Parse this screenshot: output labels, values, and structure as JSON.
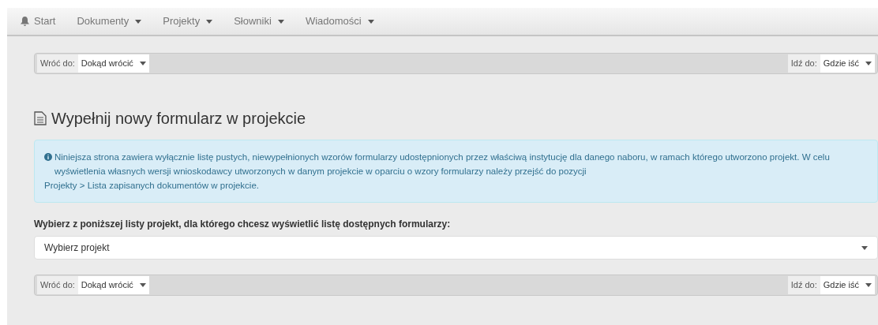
{
  "nav": [
    {
      "label": "Start",
      "kind": "home"
    },
    {
      "label": "Dokumenty",
      "kind": "dropdown"
    },
    {
      "label": "Projekty",
      "kind": "dropdown"
    },
    {
      "label": "Słowniki",
      "kind": "dropdown"
    },
    {
      "label": "Wiadomości",
      "kind": "dropdown"
    }
  ],
  "toolbars": [
    {
      "back_label": "Wróć do:",
      "back_value": "Dokąd wrócić",
      "go_label": "Idź do:",
      "go_value": "Gdzie iść"
    },
    {
      "back_label": "Wróć do:",
      "back_value": "Dokąd wrócić",
      "go_label": "Idź do:",
      "go_value": "Gdzie iść"
    }
  ],
  "heading": "Wypełnij nowy formularz w projekcie",
  "info": {
    "text": "Niniejsza strona zawiera wyłącznie listę pustych, niewypełnionych wzorów formularzy udostępnionych przez właściwą instytucję dla danego naboru, w ramach którego utworzono projekt. W celu wyświetlenia własnych wersji wnioskodawcy utworzonych w danym projekcie w oparciu o wzory formularzy należy przejść do pozycji",
    "path": "Projekty > Lista zapisanych dokumentów w projekcie."
  },
  "project_select": {
    "label": "Wybierz z poniższej listy projekt, dla którego chcesz wyświetlić listę dostępnych formularzy:",
    "value": "Wybierz projekt"
  }
}
